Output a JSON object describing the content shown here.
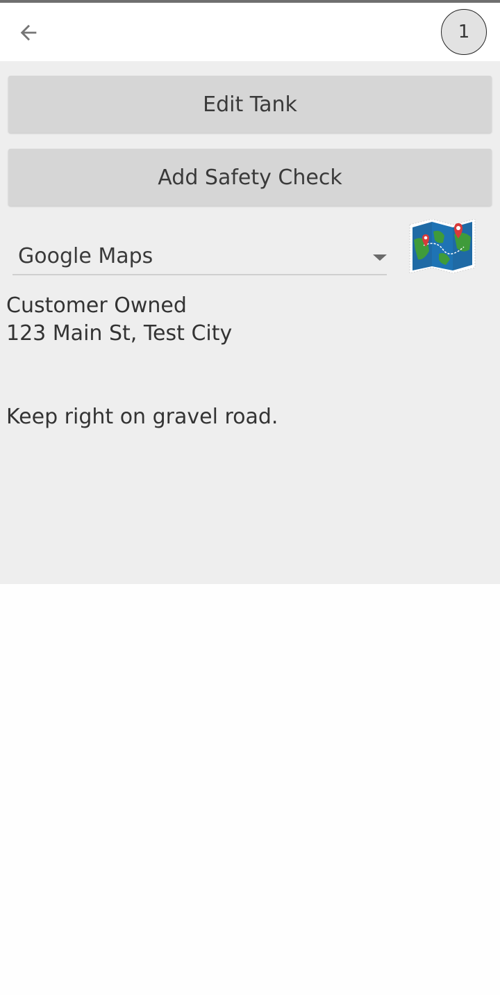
{
  "header": {
    "back_icon": "arrow-left-icon",
    "badge_count": "1"
  },
  "actions": {
    "edit_tank_label": "Edit Tank",
    "add_safety_check_label": "Add Safety Check"
  },
  "navigation": {
    "selected_app": "Google Maps",
    "map_icon": "folded-map-with-pins-icon"
  },
  "tank": {
    "ownership": "Customer Owned",
    "address": "123 Main St, Test City",
    "directions": "Keep right on gravel road."
  },
  "colors": {
    "header_bg": "#ffffff",
    "content_bg": "#eeeeee",
    "button_bg": "#d6d6d6",
    "badge_bg": "#e2e2e2",
    "top_line": "#6f6f6f"
  }
}
